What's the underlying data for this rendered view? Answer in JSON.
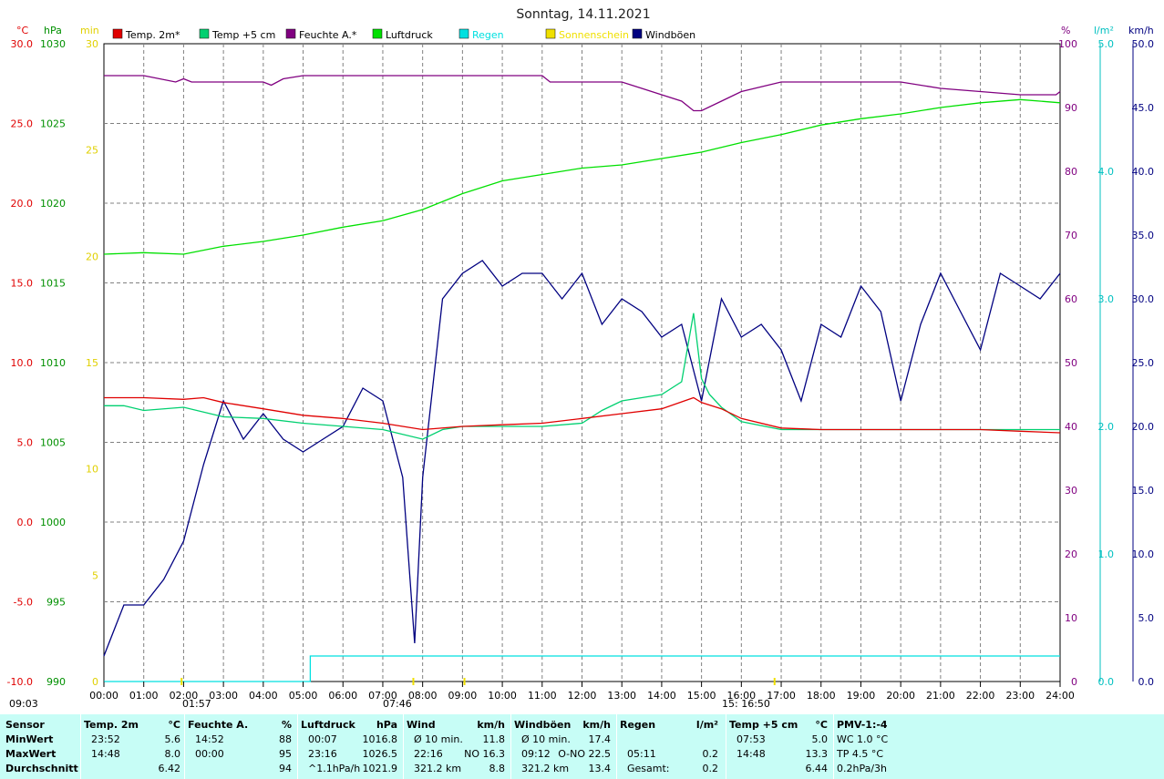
{
  "title": "Sonntag, 14.11.2021",
  "axis_units": {
    "temp": "°C",
    "pressure": "hPa",
    "sun": "min",
    "humidity": "%",
    "rain": "l/m²",
    "wind": "km/h"
  },
  "colors": {
    "temp2m": "#e00000",
    "temp5cm": "#00d070",
    "humidity": "#800080",
    "pressure": "#00e000",
    "rain": "#00e0e0",
    "sun": "#f0e000",
    "gusts": "#000080",
    "grid": "#808080",
    "temp_axis": "#e00000",
    "pressure_axis": "#009000",
    "sun_axis": "#e0d000",
    "hum_axis": "#800080",
    "rain_axis": "#00c0c0",
    "wind_axis": "#000080"
  },
  "chart_data": {
    "type": "line",
    "title": "Sonntag, 14.11.2021",
    "x_ticks": [
      "00:00",
      "01:00",
      "02:00",
      "03:00",
      "04:00",
      "05:00",
      "06:00",
      "07:00",
      "08:00",
      "09:00",
      "10:00",
      "11:00",
      "12:00",
      "13:00",
      "14:00",
      "15:00",
      "16:00",
      "17:00",
      "18:00",
      "19:00",
      "20:00",
      "21:00",
      "22:00",
      "23:00",
      "24:00"
    ],
    "axes": {
      "temp": {
        "ticks": [
          "30.0",
          "25.0",
          "20.0",
          "15.0",
          "10.0",
          "5.0",
          "0.0",
          "-5.0",
          "-10.0"
        ],
        "ylim": [
          -10,
          30
        ]
      },
      "pressure": {
        "ticks": [
          "1030",
          "1025",
          "1020",
          "1015",
          "1010",
          "1005",
          "1000",
          "995",
          "990"
        ],
        "ylim": [
          990,
          1030
        ]
      },
      "sun": {
        "ticks": [
          "30",
          "25",
          "20",
          "15",
          "10",
          "5",
          "0"
        ],
        "ylim": [
          0,
          30
        ]
      },
      "humidity": {
        "ticks": [
          "100",
          "90",
          "80",
          "70",
          "60",
          "50",
          "40",
          "30",
          "20",
          "10",
          "0"
        ],
        "ylim": [
          0,
          100
        ]
      },
      "rain": {
        "ticks": [
          "5.0",
          "4.0",
          "3.0",
          "2.0",
          "1.0",
          "0.0"
        ],
        "ylim": [
          0,
          5
        ]
      },
      "wind": {
        "ticks": [
          "50.0",
          "45.0",
          "40.0",
          "35.0",
          "30.0",
          "25.0",
          "20.0",
          "15.0",
          "10.0",
          "5.0",
          "0.0"
        ],
        "ylim": [
          0,
          50
        ]
      }
    },
    "legend": [
      "Temp. 2m*",
      "Temp +5 cm",
      "Feuchte A.*",
      "Luftdruck",
      "Regen",
      "Sonnenschein",
      "Windböen"
    ],
    "series": [
      {
        "name": "Temp. 2m*",
        "axis": "temp",
        "x": [
          0,
          1,
          2,
          2.5,
          3,
          4,
          5,
          6,
          7,
          8,
          9,
          10,
          11,
          12,
          13,
          14,
          14.8,
          15,
          15.5,
          16,
          17,
          18,
          19,
          20,
          21,
          22,
          23,
          24
        ],
        "values": [
          7.8,
          7.8,
          7.7,
          7.8,
          7.5,
          7.1,
          6.7,
          6.5,
          6.2,
          5.8,
          6.0,
          6.1,
          6.2,
          6.5,
          6.8,
          7.1,
          7.8,
          7.5,
          7.1,
          6.5,
          5.9,
          5.8,
          5.8,
          5.8,
          5.8,
          5.8,
          5.7,
          5.6
        ]
      },
      {
        "name": "Temp +5 cm",
        "axis": "temp",
        "x": [
          0,
          0.5,
          1,
          2,
          3,
          4,
          5,
          6,
          7,
          8,
          8.5,
          9,
          10,
          11,
          12,
          12.5,
          13,
          13.5,
          14,
          14.5,
          14.8,
          15,
          15.2,
          15.5,
          16,
          17,
          18,
          19,
          20,
          21,
          22,
          23,
          24
        ],
        "values": [
          7.3,
          7.3,
          7.0,
          7.2,
          6.6,
          6.5,
          6.2,
          6.0,
          5.8,
          5.2,
          5.8,
          6.0,
          6.0,
          6.0,
          6.2,
          7.0,
          7.6,
          7.8,
          8.0,
          8.8,
          13.1,
          9.0,
          8.0,
          7.2,
          6.3,
          5.8,
          5.8,
          5.8,
          5.8,
          5.8,
          5.8,
          5.8,
          5.8
        ]
      },
      {
        "name": "Feuchte A.*",
        "axis": "humidity",
        "x": [
          0,
          1,
          1.8,
          2,
          2.2,
          2.5,
          3,
          4,
          4.2,
          4.5,
          5,
          6,
          7,
          8,
          9,
          10,
          11,
          11.2,
          12,
          13,
          13.5,
          14,
          14.5,
          14.8,
          15,
          15.5,
          16,
          17,
          18,
          19,
          20,
          21,
          22,
          23,
          23.9,
          24
        ],
        "values": [
          95,
          95,
          94,
          94.5,
          94,
          94,
          94,
          94,
          93.5,
          94.5,
          95,
          95,
          95,
          95,
          95,
          95,
          95,
          94,
          94,
          94,
          93,
          92,
          91,
          89.5,
          89.5,
          91,
          92.5,
          94,
          94,
          94,
          94,
          93,
          92.5,
          92,
          92,
          92.5
        ]
      },
      {
        "name": "Luftdruck",
        "axis": "pressure",
        "x": [
          0,
          1,
          2,
          3,
          4,
          5,
          6,
          7,
          8,
          9,
          10,
          11,
          12,
          13,
          14,
          15,
          16,
          17,
          18,
          19,
          20,
          21,
          22,
          23,
          24
        ],
        "values": [
          1016.8,
          1016.9,
          1016.8,
          1017.3,
          1017.6,
          1018.0,
          1018.5,
          1018.9,
          1019.6,
          1020.6,
          1021.4,
          1021.8,
          1022.2,
          1022.4,
          1022.8,
          1023.2,
          1023.8,
          1024.3,
          1024.9,
          1025.3,
          1025.6,
          1026.0,
          1026.3,
          1026.5,
          1026.3
        ]
      },
      {
        "name": "Regen",
        "axis": "rain",
        "x": [
          0,
          5.18,
          5.18,
          24
        ],
        "values": [
          0,
          0,
          0.2,
          0.2
        ]
      },
      {
        "name": "Windböen",
        "axis": "wind",
        "x": [
          0,
          0.5,
          1,
          1.5,
          2,
          2.5,
          3,
          3.5,
          4,
          4.5,
          5,
          5.5,
          6,
          6.5,
          7,
          7.5,
          7.8,
          8,
          8.5,
          9,
          9.5,
          10,
          10.5,
          11,
          11.5,
          12,
          12.5,
          13,
          13.5,
          14,
          14.5,
          15,
          15.5,
          16,
          16.5,
          17,
          17.5,
          18,
          18.5,
          19,
          19.5,
          20,
          20.5,
          21,
          21.5,
          22,
          22.5,
          23,
          23.5,
          24
        ],
        "values": [
          2,
          6,
          6,
          8,
          11,
          17,
          22,
          19,
          21,
          19,
          18,
          19,
          20,
          23,
          22,
          16,
          3,
          16,
          30,
          32,
          33,
          31,
          32,
          32,
          30,
          32,
          28,
          30,
          29,
          27,
          28,
          22,
          30,
          27,
          28,
          26,
          22,
          28,
          27,
          31,
          29,
          22,
          28,
          32,
          29,
          26,
          32,
          31,
          30,
          32
        ]
      }
    ],
    "sun_markers": [
      {
        "label": "09:03",
        "time": "09:03"
      },
      {
        "label": "01:57",
        "time": "01:57"
      },
      {
        "label": "07:46",
        "time": "07:46"
      },
      {
        "label": "15: 16:50",
        "time": "16:50"
      }
    ],
    "grid": true
  },
  "summary": {
    "columns": [
      {
        "header": "Sensor",
        "unit": "",
        "rows": [
          "MinWert",
          "MaxWert",
          "Durchschnitt"
        ]
      },
      {
        "header": "Temp. 2m",
        "unit": "°C",
        "rows": [
          [
            "23:52",
            "5.6"
          ],
          [
            "14:48",
            "8.0"
          ],
          [
            "",
            "6.42"
          ]
        ]
      },
      {
        "header": "Feuchte A.",
        "unit": "%",
        "rows": [
          [
            "14:52",
            "88"
          ],
          [
            "00:00",
            "95"
          ],
          [
            "",
            "94"
          ]
        ]
      },
      {
        "header": "Luftdruck",
        "unit": "hPa",
        "rows": [
          [
            "00:07",
            "1016.8"
          ],
          [
            "23:16",
            "1026.5"
          ],
          [
            "^1.1hPa/h",
            "1021.9"
          ]
        ]
      },
      {
        "header": "Wind",
        "unit": "km/h",
        "rows": [
          [
            "Ø 10 min.",
            "11.8"
          ],
          [
            "22:16",
            "NO 16.3"
          ],
          [
            "321.2 km",
            "8.8"
          ]
        ]
      },
      {
        "header": "Windböen",
        "unit": "km/h",
        "rows": [
          [
            "Ø 10 min.",
            "17.4"
          ],
          [
            "09:12",
            "O-NO 22.5"
          ],
          [
            "321.2 km",
            "13.4"
          ]
        ]
      },
      {
        "header": "Regen",
        "unit": "l/m²",
        "rows": [
          [
            "",
            ""
          ],
          [
            "05:11",
            "0.2"
          ],
          [
            "Gesamt:",
            "0.2"
          ]
        ]
      },
      {
        "header": "Temp +5 cm",
        "unit": "°C",
        "rows": [
          [
            "07:53",
            "5.0"
          ],
          [
            "14:48",
            "13.3"
          ],
          [
            "",
            "6.44"
          ]
        ]
      },
      {
        "header": "PMV-1:-4",
        "unit": "",
        "rows": [
          "WC 1.0 °C",
          "TP 4.5 °C",
          "0.2hPa/3h"
        ]
      }
    ]
  }
}
